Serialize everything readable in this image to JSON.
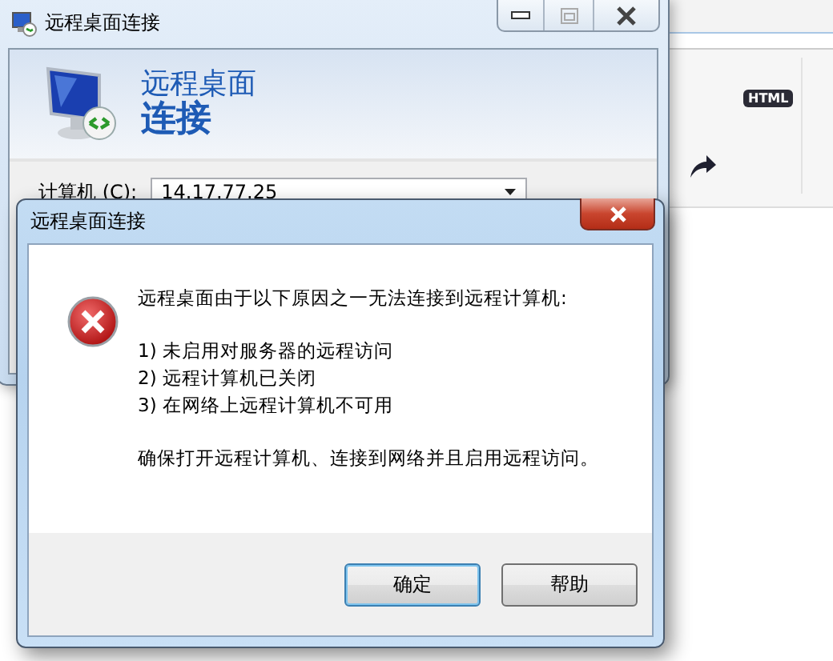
{
  "background_page": {
    "badge": "HTML"
  },
  "main_window": {
    "title": "远程桌面连接",
    "header_line1": "远程桌面",
    "header_line2": "连接",
    "computer_label": "计算机 (C):",
    "computer_value": "14.17.77.25"
  },
  "dialog": {
    "title": "远程桌面连接",
    "message": "远程桌面由于以下原因之一无法连接到远程计算机:",
    "reasons": [
      "1) 未启用对服务器的远程访问",
      "2) 远程计算机已关闭",
      "3) 在网络上远程计算机不可用"
    ],
    "advice": "确保打开远程计算机、连接到网络并且启用远程访问。",
    "buttons": [
      {
        "label": "确定",
        "default": true
      },
      {
        "label": "帮助",
        "default": false
      }
    ]
  }
}
